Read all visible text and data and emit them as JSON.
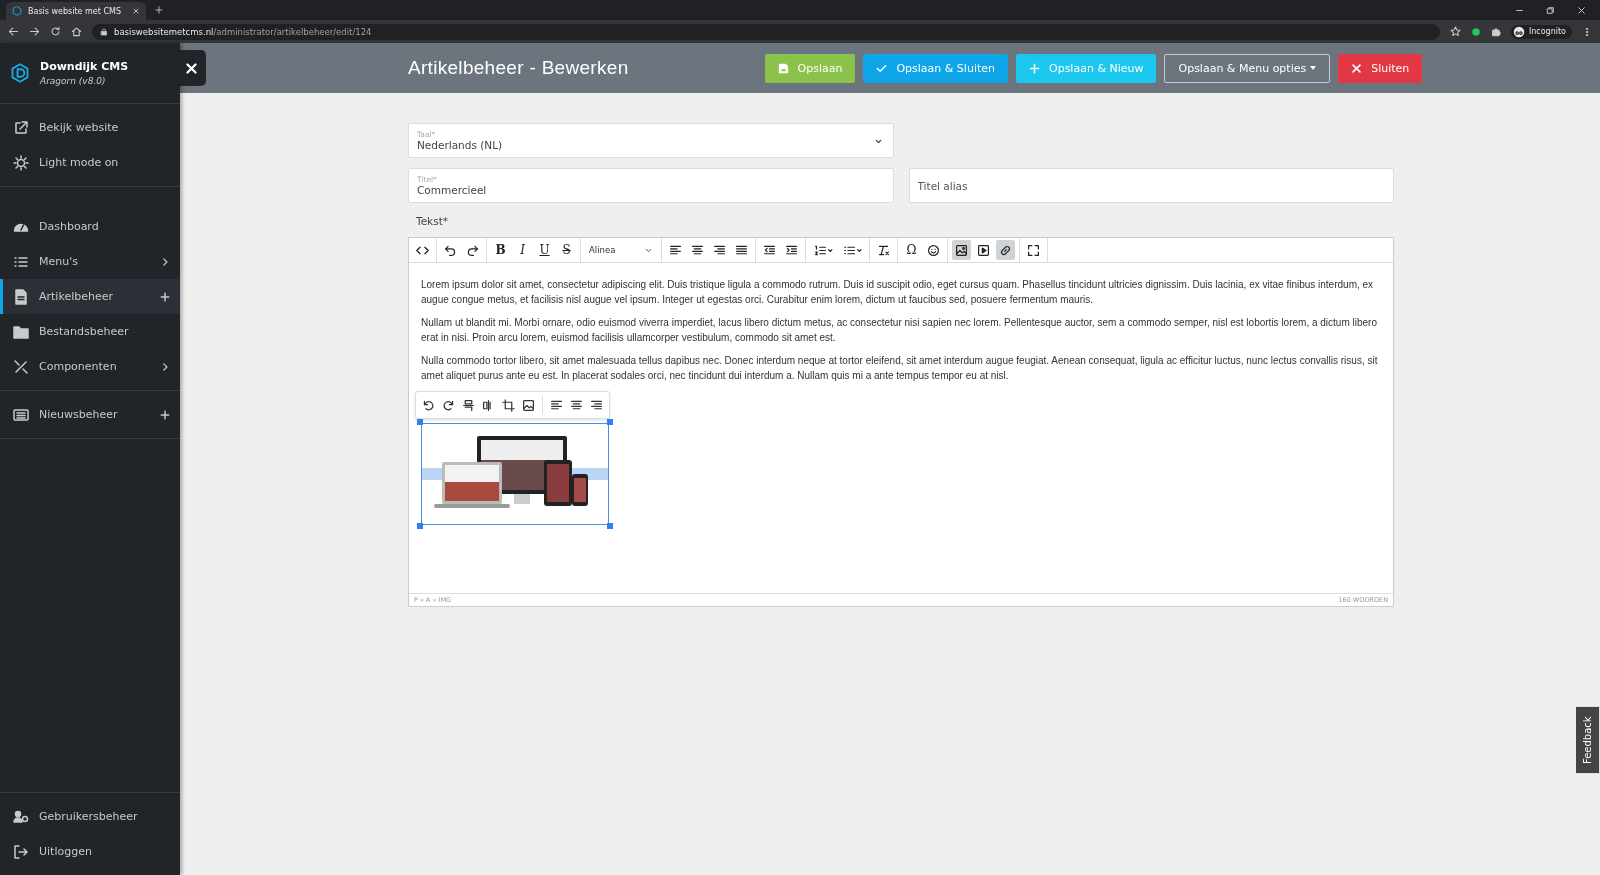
{
  "browser": {
    "tab_title": "Basis website met CMS",
    "url_host": "basiswebsitemetcms.nl",
    "url_path": "/administrator/artikelbeheer/edit/124",
    "profile": "Incognito"
  },
  "sidebar": {
    "brand": "Downdijk CMS",
    "version": "Aragorn (v8.0)",
    "top_items": [
      {
        "label": "Bekijk website"
      },
      {
        "label": "Light mode on"
      }
    ],
    "nav_items": [
      {
        "label": "Dashboard",
        "selected": false,
        "expandable": false,
        "addable": false
      },
      {
        "label": "Menu's",
        "selected": false,
        "expandable": true,
        "addable": false
      },
      {
        "label": "Artikelbeheer",
        "selected": true,
        "expandable": false,
        "addable": true
      },
      {
        "label": "Bestandsbeheer",
        "selected": false,
        "expandable": false,
        "addable": false
      },
      {
        "label": "Componenten",
        "selected": false,
        "expandable": true,
        "addable": false
      }
    ],
    "news_items": [
      {
        "label": "Nieuwsbeheer",
        "selected": false,
        "expandable": false,
        "addable": true
      }
    ],
    "bottom_items": [
      {
        "label": "Gebruikersbeheer"
      },
      {
        "label": "Uitloggen"
      }
    ]
  },
  "header": {
    "title": "Artikelbeheer - Bewerken",
    "buttons": [
      {
        "label": "Opslaan",
        "kind": "save"
      },
      {
        "label": "Opslaan & Sluiten",
        "kind": "save-close"
      },
      {
        "label": "Opslaan & Nieuw",
        "kind": "save-new"
      },
      {
        "label": "Opslaan & Menu opties",
        "kind": "menu"
      },
      {
        "label": "Sluiten",
        "kind": "close"
      }
    ]
  },
  "form": {
    "language": {
      "label": "Taal*",
      "value": "Nederlands (NL)"
    },
    "title": {
      "label": "Titel*",
      "value": "Commercieel"
    },
    "alias": {
      "placeholder": "Titel alias"
    },
    "text_label": "Tekst*"
  },
  "editor": {
    "toolbar": [
      [
        {
          "kind": "icon",
          "active": false
        }
      ],
      [
        {
          "kind": "icon",
          "active": false
        },
        {
          "kind": "icon",
          "active": false
        }
      ],
      [
        {
          "kind": "char",
          "label": "B",
          "active": false
        },
        {
          "kind": "char",
          "label": "I",
          "active": false
        },
        {
          "kind": "char",
          "label": "U",
          "active": false
        },
        {
          "kind": "char",
          "label": "S",
          "active": false
        }
      ],
      [
        {
          "kind": "select",
          "label": "Alinea",
          "active": false
        }
      ],
      [
        {
          "kind": "icon",
          "active": false
        },
        {
          "kind": "icon",
          "active": false
        },
        {
          "kind": "icon",
          "active": false
        },
        {
          "kind": "icon",
          "active": false
        }
      ],
      [
        {
          "kind": "icon",
          "active": false
        },
        {
          "kind": "icon",
          "active": false
        }
      ],
      [
        {
          "kind": "icon",
          "active": false
        },
        {
          "kind": "icon",
          "active": false
        }
      ],
      [
        {
          "kind": "icon",
          "active": false
        }
      ],
      [
        {
          "kind": "char",
          "label": "Ω",
          "active": false
        },
        {
          "kind": "icon",
          "active": false
        }
      ],
      [
        {
          "kind": "icon",
          "active": true
        },
        {
          "kind": "icon",
          "active": false
        },
        {
          "kind": "icon",
          "active": true
        }
      ],
      [
        {
          "kind": "icon",
          "active": false
        }
      ]
    ],
    "paragraphs": [
      "Lorem ipsum dolor sit amet, consectetur adipiscing elit. Duis tristique ligula a commodo rutrum. Duis id suscipit odio, eget cursus quam. Phasellus tincidunt ultricies dignissim. Duis lacinia, ex vitae finibus interdum, ex augue congue metus, et facilisis nisl augue vel ipsum. Integer ut egestas orci. Curabitur enim lorem, dictum ut faucibus sed, posuere fermentum mauris.",
      "Nullam ut blandit mi. Morbi ornare, odio euismod viverra imperdiet, lacus libero dictum metus, ac consectetur nisi sapien nec lorem. Pellentesque auctor, sem a commodo semper, nisl est lobortis lorem, a dictum libero erat in nisi. Proin arcu lorem, euismod facilisis ullamcorper vestibulum, commodo sit amet est.",
      "Nulla commodo tortor libero, sit amet malesuada tellus dapibus nec. Donec interdum neque at tortor eleifend, sit amet interdum augue feugiat. Aenean consequat, ligula ac efficitur luctus, nunc lectus convallis risus, sit amet aliquet purus ante eu est. In placerat sodales orci, nec tincidunt dui interdum a. Nullam quis mi a ante tempus tempor eu at nisl."
    ],
    "path": "P » A » IMG",
    "word_count": "160 WOORDEN"
  },
  "feedback": "Feedback"
}
